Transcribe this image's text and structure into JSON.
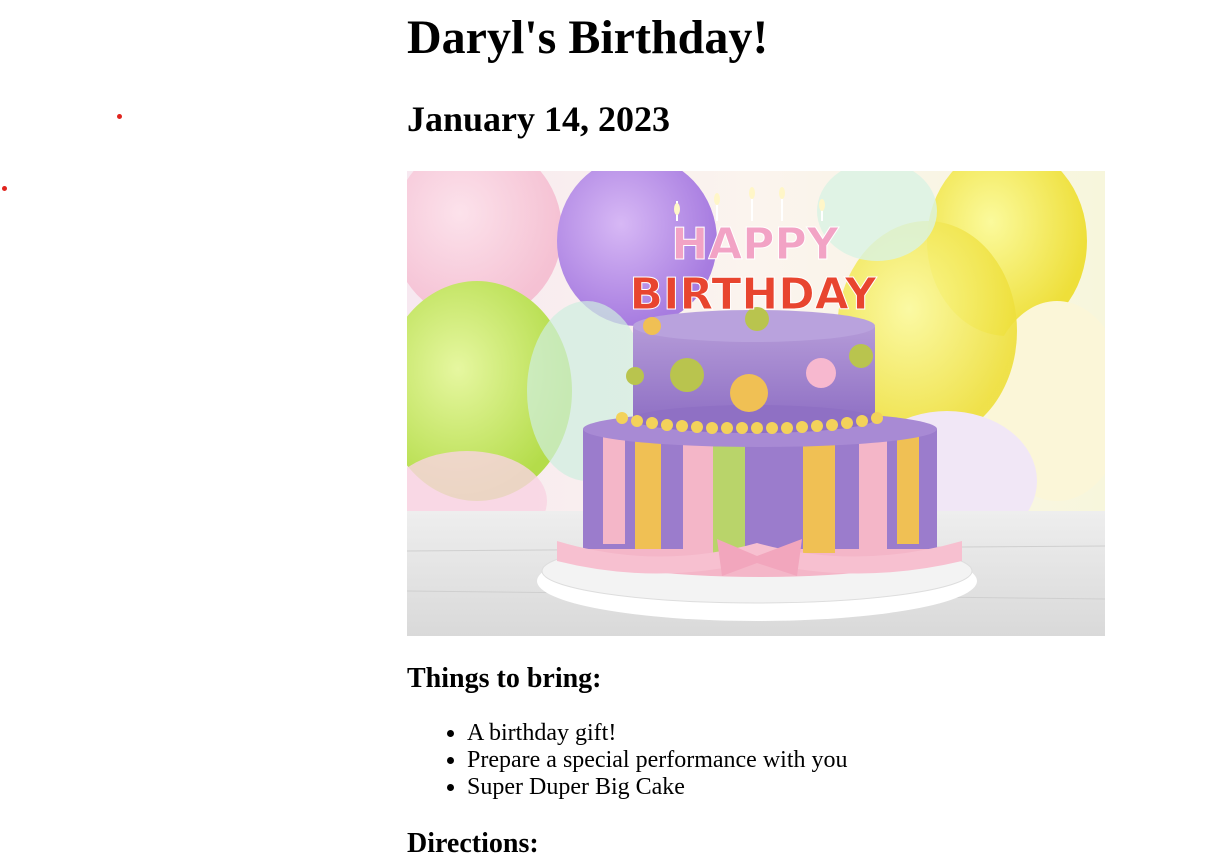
{
  "event": {
    "title": "Daryl's Birthday!",
    "date": "January 14, 2023"
  },
  "image": {
    "cake_text_line1": "HAPPY",
    "cake_text_line2": "BIRTHDAY"
  },
  "things_to_bring": {
    "heading": "Things to bring:",
    "items": [
      "A birthday gift!",
      "Prepare a special performance with you",
      "Super Duper Big Cake"
    ]
  },
  "directions": {
    "heading": "Directions:"
  },
  "colors": {
    "dot_red": "#e0241e",
    "cake_purple": "#9b7ccc",
    "balloon_yellow": "#f4f06a",
    "balloon_green": "#c6e86a",
    "ribbon_pink": "#f4b6c8"
  }
}
